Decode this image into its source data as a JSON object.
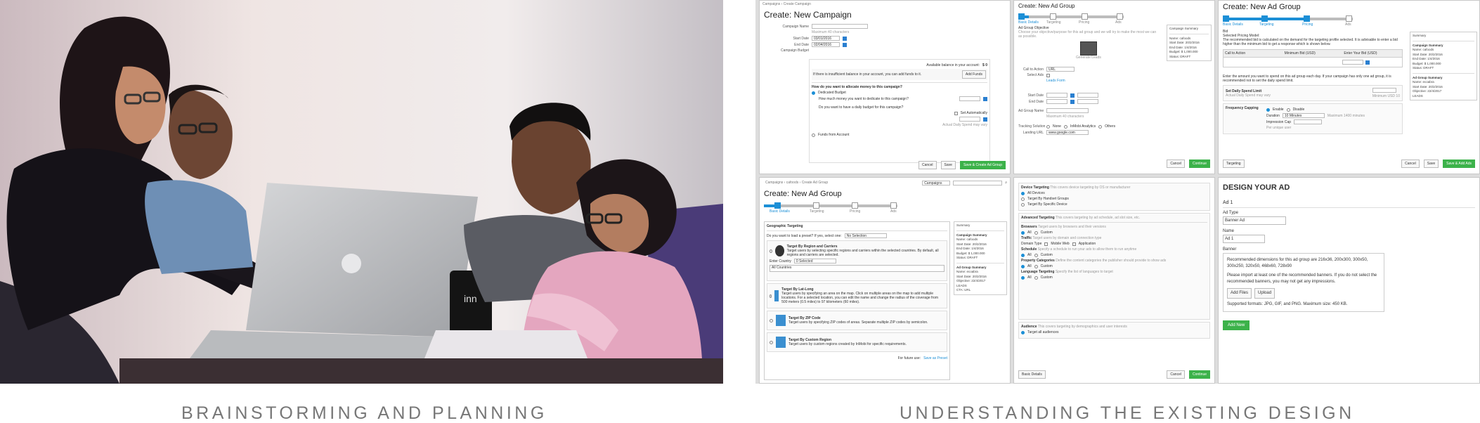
{
  "captions": {
    "left": "BRAINSTORMING AND PLANNING",
    "right": "UNDERSTANDING THE EXISTING DESIGN"
  },
  "photo": {
    "laptop_sticker": "inn"
  },
  "colors": {
    "accent_blue": "#1c8fd6",
    "action_green": "#3cb24a",
    "caption_gray": "#777777"
  },
  "panel_campaign": {
    "breadcrumb": "Campaigns › Create Campaign",
    "title": "Create: New Campaign",
    "fields": {
      "name_label": "Campaign Name",
      "name_hint": "Maximum 40 characters",
      "start_label": "Start Date",
      "start_value": "03/01/2016",
      "end_label": "End Date",
      "end_value": "02/04/2016",
      "budget_label": "Campaign Budget"
    },
    "balance_label": "Available balance in your account:",
    "balance_value": "$ 0",
    "balance_warning": "If there is insufficient balance in your account, you can add funds to it.",
    "add_funds": "Add Funds",
    "allocate_q": "How do you want to allocate money to this campaign?",
    "dedicated": "Dedicated Budget",
    "dedicate_q": "How much money you want to dedicate to this campaign?",
    "daily_q": "Do you want to have a daily budget for this campaign?",
    "set_auto": "Set Automatically",
    "daily_hint": "Actual Daily Spend may vary",
    "funds_from": "Funds from Account",
    "cancel": "Cancel",
    "save": "Save",
    "save_create": "Save & Create Ad Group"
  },
  "panel_adgroup_top": {
    "title": "Create: New Ad Group",
    "steps": [
      "Basic Details",
      "Targeting",
      "Pricing",
      "Ads"
    ],
    "objective_label": "Ad Group Objective",
    "objective_hint": "Choose your objective/purpose for this ad group and we will try to make the most we can as possible.",
    "objective_name": "Generate Leads",
    "call_action": "Call to Action",
    "call_value": "URL",
    "select_ads": "Select Ads",
    "leads_form": "Leads Form",
    "start_date": "Start Date",
    "end_date": "End Date",
    "ad_group_name": "Ad Group Name",
    "max_chars": "Maximum 40 characters",
    "tracking": "Tracking Solution",
    "none": "None",
    "analytics": "InMobi Analytics",
    "others": "Others",
    "landing": "Landing URL",
    "landing_value": "www.google.com",
    "cancel": "Cancel",
    "continue": "Continue",
    "summary_title": "Campaign Summary",
    "summary": [
      "Name: cafoods",
      "Start Date: 20/2/2016",
      "End Date: 1/4/2016",
      "Budget: $ 1,000.000",
      "Status: DRAFT"
    ]
  },
  "panel_pricing": {
    "title": "Create: New Ad Group",
    "steps": [
      "Basic Details",
      "Targeting",
      "Pricing",
      "Ads"
    ],
    "bid": "Bid",
    "model": "Selected Pricing Model:",
    "model_note": "The recommended bid is calculated on the demand for the targeting profile selected. It is advisable to enter a bid higher than the minimum bid to get a response which is shown below.",
    "cols": [
      "Call to Action",
      "Minimum Bid (USD)",
      "Enter Your Bid (USD)"
    ],
    "daily_note": "Enter the amount you want to spend on this ad group each day. If your campaign has only one ad group, it is recommended not to set the daily spend limit.",
    "daily_label": "Set Daily Spend Limit",
    "daily_hint": "Actual Daily Spend may vary",
    "daily_min": "Minimum USD 10",
    "frequency": "Frequency Capping",
    "enable": "Enable",
    "disable": "Disable",
    "duration": "Duration",
    "duration_value": "10 Minutes",
    "duration_max": "Maximum 1400 minutes",
    "impression_cap": "Impression Cap",
    "per_user": "Per unique user",
    "targeting_btn": "Targeting",
    "cancel": "Cancel",
    "save": "Save",
    "save_add": "Save & Add Ads",
    "summary_title": "Summary",
    "campaign_summary": "Campaign Summary",
    "campaign_lines": [
      "Name: cafoods",
      "Start Date: 20/2/2016",
      "End Date: 1/4/2016",
      "Budget: $ 1,000.000",
      "Status: DRAFT"
    ],
    "adgroup_summary": "Ad Group Summary",
    "adgroup_lines": [
      "Name: ecoabra",
      "Start Date: 20/2/2016",
      "Objective: 22/4/2017",
      "LEADS"
    ]
  },
  "panel_geo": {
    "breadcrumb": "Campaigns › cafoods › Create Ad Group",
    "campaigns_dd": "Campaigns",
    "title": "Create: New Ad Group",
    "steps": [
      "Basic Details",
      "Targeting",
      "Pricing",
      "Ads"
    ],
    "section": "Geographic Targeting",
    "preset_q": "Do you want to load a preset? If yes, select one:",
    "preset_value": "No Selection",
    "opt_region": "Target By Region and Carriers",
    "opt_region_desc": "Target users by selecting specific regions and carriers within the selected countries. By default, all regions and carriers are selected.",
    "enter_country": "Enter Country",
    "country_value": "0 Selected",
    "all_countries": "All Countries",
    "opt_latlong": "Target By Lat-Long",
    "opt_latlong_desc": "Target users by specifying an area on the map. Click on multiple areas on the map to add multiple locations. For a selected location, you can edit the name and change the radius of the coverage from 500 meters (0.5 miles) to 97 kilometers (60 miles).",
    "opt_zip": "Target By ZIP Code",
    "opt_zip_desc": "Target users by specifying ZIP codes of areas. Separate multiple ZIP codes by semicolon.",
    "opt_custom": "Target By Custom Region",
    "opt_custom_desc": "Target users by custom regions created by InMobi for specific requirements.",
    "save_preset_q": "For future use:",
    "save_preset": "Save as Preset",
    "summary_title": "Summary",
    "campaign_summary": "Campaign Summary",
    "campaign_lines": [
      "Name: cafoods",
      "Start Date: 20/2/2016",
      "End Date: 1/4/2016",
      "Budget: $ 1,000.000",
      "Status: DRAFT"
    ],
    "adgroup_summary": "Ad Group Summary",
    "adgroup_lines": [
      "Name: ecoabra",
      "Start Date: 20/2/2016",
      "Objective: 22/4/2017",
      "LEADS",
      "CTA: URL"
    ]
  },
  "panel_device": {
    "device": "Device Targeting",
    "device_hint": "This covers device targeting by OS or manufacturer",
    "opt_all": "All Devices",
    "opt_handset": "Target By Handset Groups",
    "opt_specific": "Target By Specific Device",
    "advanced": "Advanced Targeting",
    "advanced_hint": "This covers targeting by ad schedule, ad slot size, etc.",
    "browsers": "Browsers",
    "browsers_hint": "Target users by browsers and their versions",
    "all": "All",
    "custom": "Custom",
    "traffic": "Traffic",
    "traffic_hint": "Target users by domain and connection type",
    "domain_type": "Domain Type",
    "mobile_web": "Mobile Web",
    "application": "Application",
    "schedule": "Schedule",
    "schedule_hint": "Specify a schedule to run your ads to allow them to run anytime",
    "property": "Property Categories",
    "property_hint": "Define the content categories the publisher should provide to show ads",
    "language": "Language Targeting",
    "language_hint": "Specify the list of languages to target",
    "audience": "Audience",
    "audience_hint": "This covers targeting by demographics and user interests",
    "target_all": "Target all audiences",
    "basic_details": "Basic Details",
    "cancel": "Cancel",
    "continue": "Continue"
  },
  "panel_design": {
    "title": "DESIGN YOUR AD",
    "ad_name": "Ad 1",
    "ad_type_label": "Ad Type",
    "ad_type_value": "Banner Ad",
    "name_label": "Name",
    "name_value": "Ad 1",
    "banner_label": "Banner",
    "recommended": "Recommended dimensions for this ad group are 216x36, 200x300, 300x50, 300x250, 320x50, 468x60, 728x90",
    "import_note": "Please import at least one of the recommended banners. If you do not select the recommended banners, you may not get any impressions.",
    "add_files": "Add Files",
    "upload": "Upload",
    "formats": "Supported formats: JPG, GIF, and PNG. Maximum size: 450 KB.",
    "add_new": "Add New"
  }
}
